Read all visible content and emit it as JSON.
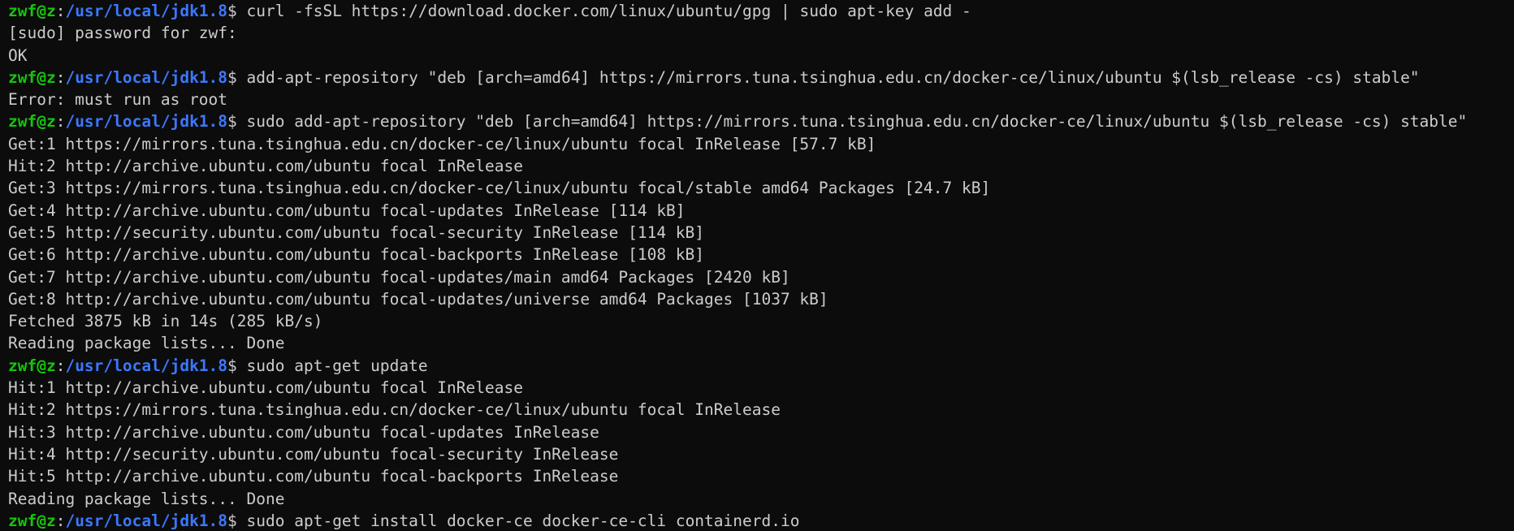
{
  "window": {
    "theme": {
      "background": "#0c0c0c",
      "foreground": "#cccccc",
      "user_color": "#16c60c",
      "path_color": "#3b78ff"
    }
  },
  "prompt": {
    "user": "zwf@z",
    "separator": ":",
    "path": "/usr/local/jdk1.8",
    "symbol": "$ "
  },
  "lines": [
    {
      "type": "prompt",
      "text": "curl -fsSL https://download.docker.com/linux/ubuntu/gpg | sudo apt-key add -"
    },
    {
      "type": "output",
      "text": "[sudo] password for zwf:"
    },
    {
      "type": "output",
      "text": "OK"
    },
    {
      "type": "prompt",
      "text": "add-apt-repository \"deb [arch=amd64] https://mirrors.tuna.tsinghua.edu.cn/docker-ce/linux/ubuntu $(lsb_release -cs) stable\""
    },
    {
      "type": "output",
      "text": "Error: must run as root"
    },
    {
      "type": "prompt",
      "text": "sudo add-apt-repository \"deb [arch=amd64] https://mirrors.tuna.tsinghua.edu.cn/docker-ce/linux/ubuntu $(lsb_release -cs) stable\""
    },
    {
      "type": "output",
      "text": "Get:1 https://mirrors.tuna.tsinghua.edu.cn/docker-ce/linux/ubuntu focal InRelease [57.7 kB]"
    },
    {
      "type": "output",
      "text": "Hit:2 http://archive.ubuntu.com/ubuntu focal InRelease"
    },
    {
      "type": "output",
      "text": "Get:3 https://mirrors.tuna.tsinghua.edu.cn/docker-ce/linux/ubuntu focal/stable amd64 Packages [24.7 kB]"
    },
    {
      "type": "output",
      "text": "Get:4 http://archive.ubuntu.com/ubuntu focal-updates InRelease [114 kB]"
    },
    {
      "type": "output",
      "text": "Get:5 http://security.ubuntu.com/ubuntu focal-security InRelease [114 kB]"
    },
    {
      "type": "output",
      "text": "Get:6 http://archive.ubuntu.com/ubuntu focal-backports InRelease [108 kB]"
    },
    {
      "type": "output",
      "text": "Get:7 http://archive.ubuntu.com/ubuntu focal-updates/main amd64 Packages [2420 kB]"
    },
    {
      "type": "output",
      "text": "Get:8 http://archive.ubuntu.com/ubuntu focal-updates/universe amd64 Packages [1037 kB]"
    },
    {
      "type": "output",
      "text": "Fetched 3875 kB in 14s (285 kB/s)"
    },
    {
      "type": "output",
      "text": "Reading package lists... Done"
    },
    {
      "type": "prompt",
      "text": "sudo apt-get update"
    },
    {
      "type": "output",
      "text": "Hit:1 http://archive.ubuntu.com/ubuntu focal InRelease"
    },
    {
      "type": "output",
      "text": "Hit:2 https://mirrors.tuna.tsinghua.edu.cn/docker-ce/linux/ubuntu focal InRelease"
    },
    {
      "type": "output",
      "text": "Hit:3 http://archive.ubuntu.com/ubuntu focal-updates InRelease"
    },
    {
      "type": "output",
      "text": "Hit:4 http://security.ubuntu.com/ubuntu focal-security InRelease"
    },
    {
      "type": "output",
      "text": "Hit:5 http://archive.ubuntu.com/ubuntu focal-backports InRelease"
    },
    {
      "type": "output",
      "text": "Reading package lists... Done"
    },
    {
      "type": "prompt",
      "text": "sudo apt-get install docker-ce docker-ce-cli containerd.io"
    }
  ]
}
